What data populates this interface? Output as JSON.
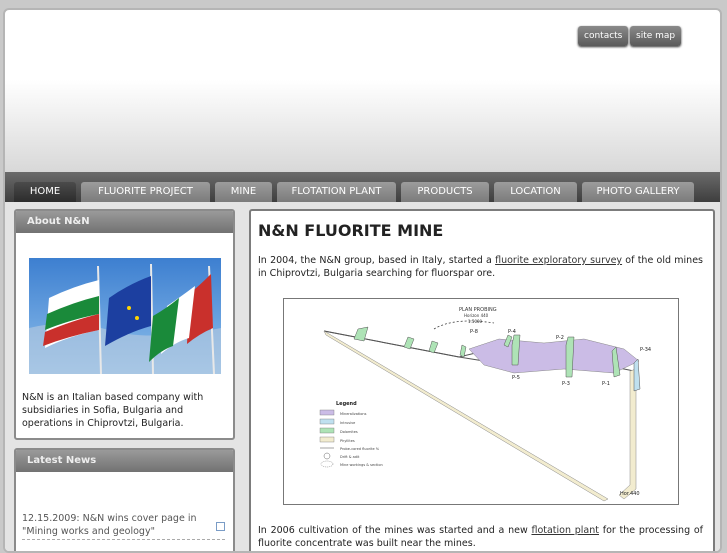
{
  "header": {
    "buttons": [
      "contacts",
      "site map"
    ]
  },
  "nav": {
    "tabs": [
      "HOME",
      "FLUORITE PROJECT",
      "MINE",
      "FLOTATION PLANT",
      "PRODUCTS",
      "LOCATION",
      "PHOTO GALLERY"
    ],
    "active": "HOME"
  },
  "sidebar": {
    "about": {
      "title": "About N&N",
      "text": "N&N is an Italian based company with subsidiaries in Sofia, Bulgaria and operations in Chiprovtzi, Bulgaria."
    },
    "news": {
      "title": "Latest News",
      "items": [
        {
          "text": "12.15.2009: N&N wins cover page in \"Mining works and geology\""
        }
      ]
    }
  },
  "main": {
    "title": "N&N FLUORITE MINE",
    "para1": {
      "before": "In 2004, the N&N group, based in Italy, started a ",
      "link": "fluorite exploratory survey",
      "after": " of the old mines in Chiprovtzi, Bulgaria searching for fluorspar ore."
    },
    "map": {
      "title": "PLAN PROBING",
      "subtitle": "Horizon 440",
      "scale": "1:5000",
      "points": [
        "P-8",
        "P-4",
        "P-2",
        "P-34",
        "P-5",
        "P-3",
        "P-1"
      ],
      "horizon_label": "Hor.440",
      "legend_title": "Legend",
      "legend_items": [
        "Mineralizations",
        "Intrusive",
        "Dolomites",
        "Phyllites",
        "Probe-cored fluorite %",
        "Drift & adit",
        "Mine workings & section"
      ]
    },
    "para2": {
      "before": "In 2006 cultivation of the mines was started and a new ",
      "link": "flotation plant",
      "after": " for the processing of fluorite concentrate was built near the mines."
    }
  }
}
